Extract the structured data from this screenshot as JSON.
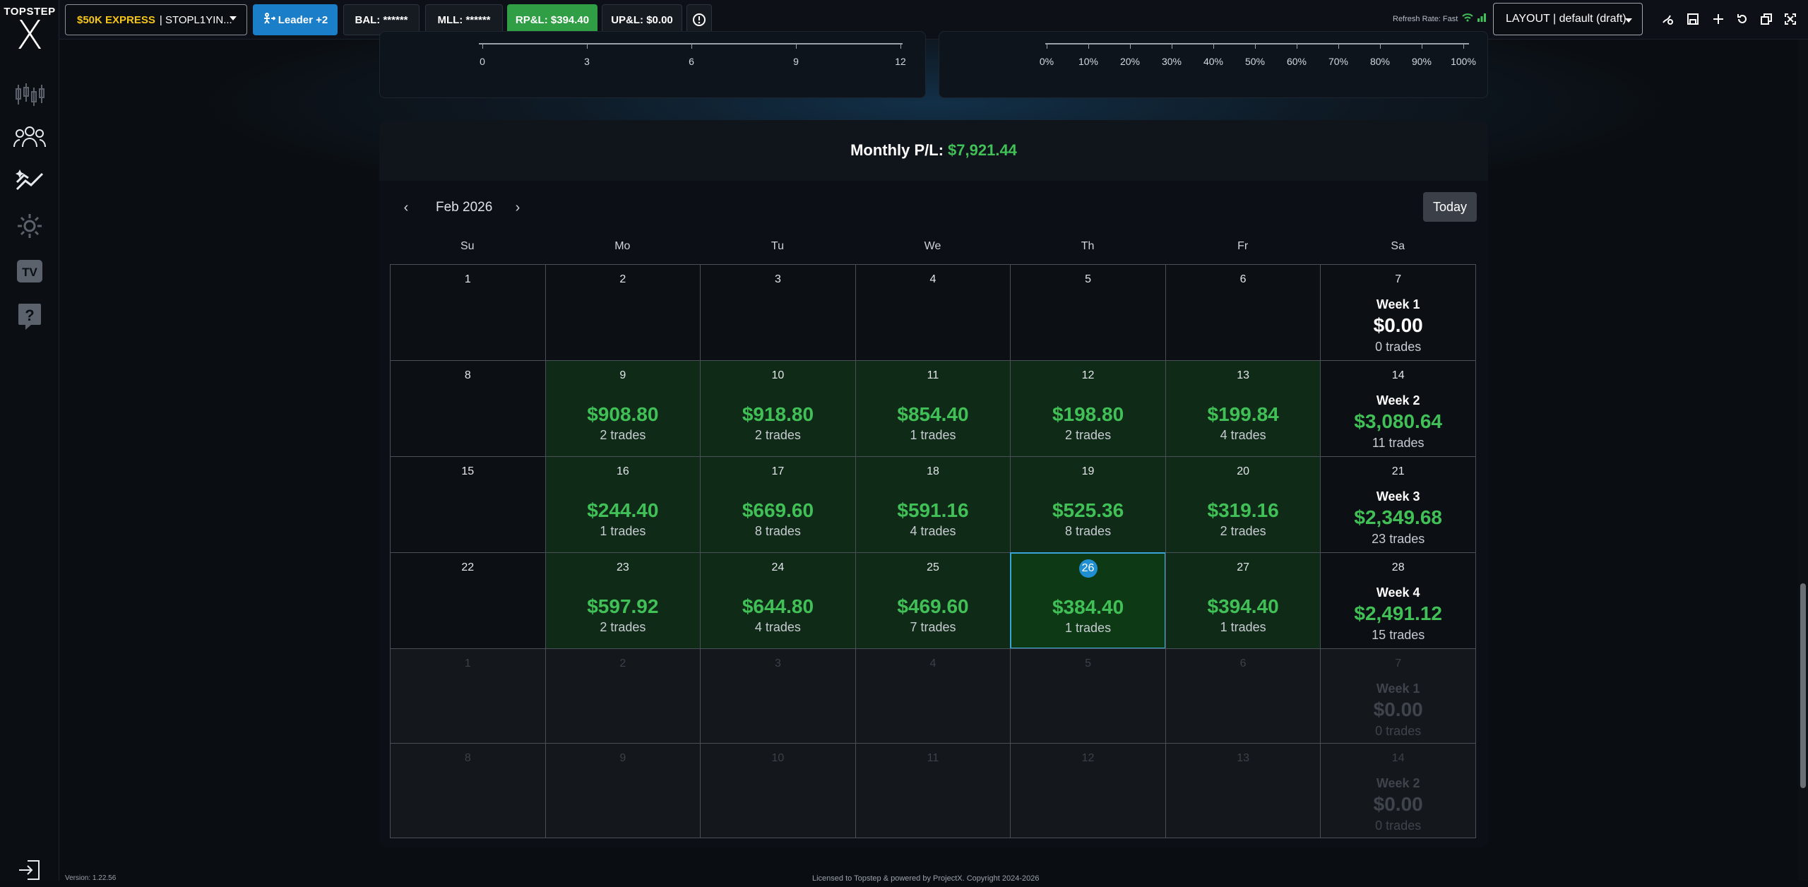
{
  "logo": {
    "top": "TOPSTEP",
    "mark": "X"
  },
  "topbar": {
    "account_tier": "$50K EXPRESS",
    "account_id": "| STOPL1YIN...",
    "leader": "Leader +2",
    "bal": "BAL: ******",
    "mll": "MLL: ******",
    "rpl": "RP&L: $394.40",
    "upl": "UP&L: $0.00",
    "refresh": "Refresh Rate: Fast",
    "layout": "LAYOUT | default (draft)"
  },
  "axis_left": {
    "ticks": [
      "0",
      "3",
      "6",
      "9",
      "12"
    ]
  },
  "axis_right": {
    "ticks": [
      "0%",
      "10%",
      "20%",
      "30%",
      "40%",
      "50%",
      "60%",
      "70%",
      "80%",
      "90%",
      "100%"
    ]
  },
  "calendar": {
    "title": "Monthly P/L:",
    "total": "$7,921.44",
    "month": "Feb 2026",
    "today": "Today",
    "dow": [
      "Su",
      "Mo",
      "Tu",
      "We",
      "Th",
      "Fr",
      "Sa"
    ],
    "rows": [
      [
        {
          "d": "1"
        },
        {
          "d": "2"
        },
        {
          "d": "3"
        },
        {
          "d": "4"
        },
        {
          "d": "5"
        },
        {
          "d": "6"
        },
        {
          "d": "7",
          "week": "Week 1",
          "wamt": "$0.00",
          "wtrd": "0 trades",
          "zero": true
        }
      ],
      [
        {
          "d": "8"
        },
        {
          "d": "9",
          "amt": "$908.80",
          "trd": "2 trades"
        },
        {
          "d": "10",
          "amt": "$918.80",
          "trd": "2 trades"
        },
        {
          "d": "11",
          "amt": "$854.40",
          "trd": "1 trades"
        },
        {
          "d": "12",
          "amt": "$198.80",
          "trd": "2 trades"
        },
        {
          "d": "13",
          "amt": "$199.84",
          "trd": "4 trades"
        },
        {
          "d": "14",
          "week": "Week 2",
          "wamt": "$3,080.64",
          "wtrd": "11 trades"
        }
      ],
      [
        {
          "d": "15"
        },
        {
          "d": "16",
          "amt": "$244.40",
          "trd": "1 trades"
        },
        {
          "d": "17",
          "amt": "$669.60",
          "trd": "8 trades"
        },
        {
          "d": "18",
          "amt": "$591.16",
          "trd": "4 trades"
        },
        {
          "d": "19",
          "amt": "$525.36",
          "trd": "8 trades"
        },
        {
          "d": "20",
          "amt": "$319.16",
          "trd": "2 trades"
        },
        {
          "d": "21",
          "week": "Week 3",
          "wamt": "$2,349.68",
          "wtrd": "23 trades"
        }
      ],
      [
        {
          "d": "22"
        },
        {
          "d": "23",
          "amt": "$597.92",
          "trd": "2 trades"
        },
        {
          "d": "24",
          "amt": "$644.80",
          "trd": "4 trades"
        },
        {
          "d": "25",
          "amt": "$469.60",
          "trd": "7 trades"
        },
        {
          "d": "26",
          "amt": "$384.40",
          "trd": "1 trades",
          "sel": true
        },
        {
          "d": "27",
          "amt": "$394.40",
          "trd": "1 trades"
        },
        {
          "d": "28",
          "week": "Week 4",
          "wamt": "$2,491.12",
          "wtrd": "15 trades"
        }
      ],
      [
        {
          "d": "1",
          "next": true
        },
        {
          "d": "2",
          "next": true
        },
        {
          "d": "3",
          "next": true
        },
        {
          "d": "4",
          "next": true
        },
        {
          "d": "5",
          "next": true
        },
        {
          "d": "6",
          "next": true
        },
        {
          "d": "7",
          "next": true,
          "week": "Week 1",
          "wamt": "$0.00",
          "wtrd": "0 trades"
        }
      ],
      [
        {
          "d": "8",
          "next": true
        },
        {
          "d": "9",
          "next": true
        },
        {
          "d": "10",
          "next": true
        },
        {
          "d": "11",
          "next": true
        },
        {
          "d": "12",
          "next": true
        },
        {
          "d": "13",
          "next": true
        },
        {
          "d": "14",
          "next": true,
          "week": "Week 2",
          "wamt": "$0.00",
          "wtrd": "0 trades"
        }
      ]
    ]
  },
  "footer": {
    "version": "Version: 1.22.56",
    "legal": "Licensed to Topstep & powered by ProjectX. Copyright 2024-2026"
  }
}
